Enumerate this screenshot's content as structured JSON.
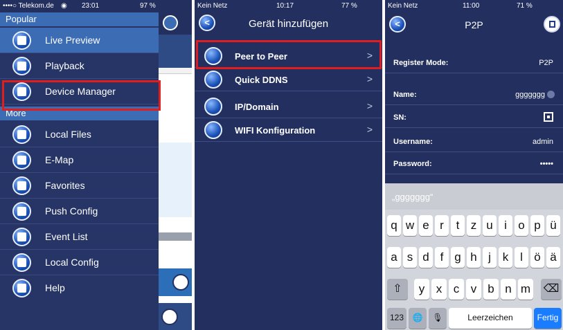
{
  "panel1": {
    "status": {
      "carrier": "••••○ Telekom.de",
      "wifi": "◉",
      "time": "23:01",
      "battery": "97 %"
    },
    "sections": {
      "popular": "Popular",
      "more": "More"
    },
    "items_popular": [
      {
        "label": "Live Preview",
        "icon": "camera-icon"
      },
      {
        "label": "Playback",
        "icon": "playback-icon"
      },
      {
        "label": "Device Manager",
        "icon": "device-manager-icon"
      }
    ],
    "items_more": [
      {
        "label": "Local Files",
        "icon": "folder-icon"
      },
      {
        "label": "E-Map",
        "icon": "map-pin-icon"
      },
      {
        "label": "Favorites",
        "icon": "star-icon"
      },
      {
        "label": "Push Config",
        "icon": "push-icon"
      },
      {
        "label": "Event List",
        "icon": "mail-icon"
      },
      {
        "label": "Local Config",
        "icon": "gear-icon"
      },
      {
        "label": "Help",
        "icon": "help-icon"
      }
    ],
    "highlighted": "Device Manager"
  },
  "panel2": {
    "status": {
      "carrier": "Kein Netz",
      "time": "10:17",
      "battery": "77 %"
    },
    "title": "Gerät hinzufügen",
    "items": [
      {
        "label": "Peer to Peer",
        "icon": "p2p-icon"
      },
      {
        "label": "Quick DDNS",
        "icon": "ddns-icon"
      },
      {
        "label": "IP/Domain",
        "icon": "ip-icon"
      },
      {
        "label": "WIFI Konfiguration",
        "icon": "wifi-icon"
      }
    ],
    "chevron": ">",
    "highlighted": "Peer to Peer"
  },
  "panel3": {
    "status": {
      "carrier": "Kein Netz",
      "time": "11:00",
      "battery": "71 %"
    },
    "title": "P2P",
    "fields": {
      "register_mode": {
        "label": "Register Mode:",
        "value": "P2P"
      },
      "name": {
        "label": "Name:",
        "value": "ggggggg"
      },
      "sn": {
        "label": "SN:",
        "value": ""
      },
      "username": {
        "label": "Username:",
        "value": "admin"
      },
      "password": {
        "label": "Password:",
        "value": "•••••"
      }
    },
    "keyboard": {
      "suggestion": "„ggggggg“",
      "row1": [
        "q",
        "w",
        "e",
        "r",
        "t",
        "z",
        "u",
        "i",
        "o",
        "p",
        "ü"
      ],
      "row2": [
        "a",
        "s",
        "d",
        "f",
        "g",
        "h",
        "j",
        "k",
        "l",
        "ö",
        "ä"
      ],
      "row3": [
        "y",
        "x",
        "c",
        "v",
        "b",
        "n",
        "m"
      ],
      "shift": "⇧",
      "backspace": "⌫",
      "numbers": "123",
      "globe": "🌐",
      "mic": "🎙",
      "space": "Leerzeichen",
      "done": "Fertig"
    }
  },
  "colors": {
    "nav_bg": "#23305f",
    "section_bg": "#3b6cb4",
    "highlight": "#e01e1e",
    "accent": "#1a7cff"
  }
}
